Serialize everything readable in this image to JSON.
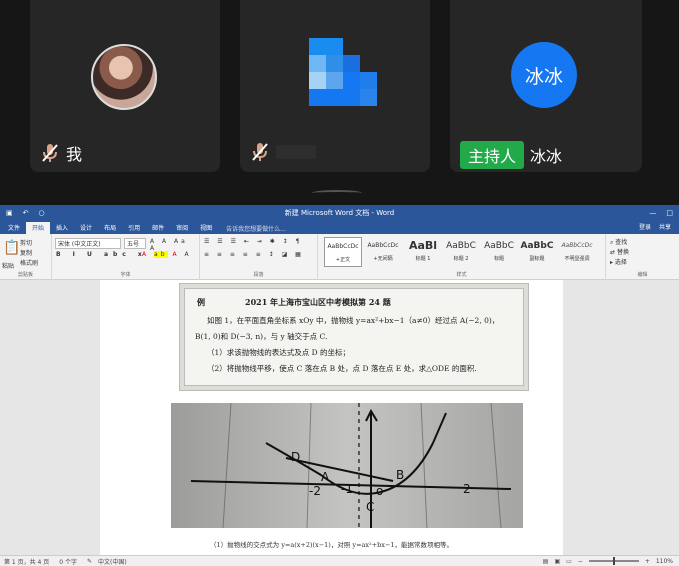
{
  "conference": {
    "participants": [
      {
        "name": "我",
        "muted": true
      },
      {
        "name": "",
        "muted": true
      },
      {
        "name": "冰冰",
        "avatar_text": "冰冰",
        "host_badge": "主持人",
        "muted": false
      }
    ],
    "colors": {
      "host_badge": "#22a94a",
      "avatar_blue": "#1677f2",
      "tile_bg": "#262626"
    }
  },
  "word": {
    "window_title": "新建 Microsoft Word 文档 - Word",
    "title_right": [
      "登录",
      "共享"
    ],
    "tabs": [
      "文件",
      "开始",
      "插入",
      "设计",
      "布局",
      "引用",
      "邮件",
      "审阅",
      "视图"
    ],
    "active_tab": "开始",
    "search_placeholder": "告诉我您想要做什么...",
    "ribbon": {
      "clipboard_label": "剪贴板",
      "paste": "粘贴",
      "cut": "剪切",
      "copy": "复制",
      "format_painter": "格式刷",
      "font_name": "宋体 (中文正文)",
      "font_size": "五号",
      "font_label": "字体",
      "paragraph_label": "段落",
      "styles_label": "样式",
      "editing_label": "编辑",
      "find": "查找",
      "replace": "替换",
      "select": "选择",
      "styles": [
        {
          "preview": "AaBbCcDc",
          "name": "+正文"
        },
        {
          "preview": "AaBbCcDc",
          "name": "+无间隔"
        },
        {
          "preview": "AaBl",
          "name": "标题 1"
        },
        {
          "preview": "AaBbC",
          "name": "标题 2"
        },
        {
          "preview": "AaBbC",
          "name": "标题"
        },
        {
          "preview": "AaBbC",
          "name": "副标题"
        },
        {
          "preview": "AaBbCcDc",
          "name": "不明显强调"
        }
      ]
    },
    "document": {
      "question_label": "例",
      "question_title": "2021 年上海市宝山区中考模拟第 24 题",
      "lines": [
        "如图 1，在平面直角坐标系 xOy 中，抛物线 y=ax²+bx−1（a≠0）经过点 A(−2, 0)，",
        "B(1, 0)和 D(−3, n)，与 y 轴交于点 C.",
        "（1）求该抛物线的表达式及点 D 的坐标；",
        "（2）将抛物线平移，使点 C 落在点 B 处，点 D 落在点 E 处，求△ODE 的面积."
      ],
      "caption": "（1）抛物线的交点式为 y=a(x+2)(x−1)，对照 y=ax²+bx−1，能据常数项相等。"
    },
    "statusbar": {
      "page_info": "第 1 页，共 4 页",
      "word_count": "0 个字",
      "language": "中文(中国)",
      "zoom": "110%"
    }
  }
}
